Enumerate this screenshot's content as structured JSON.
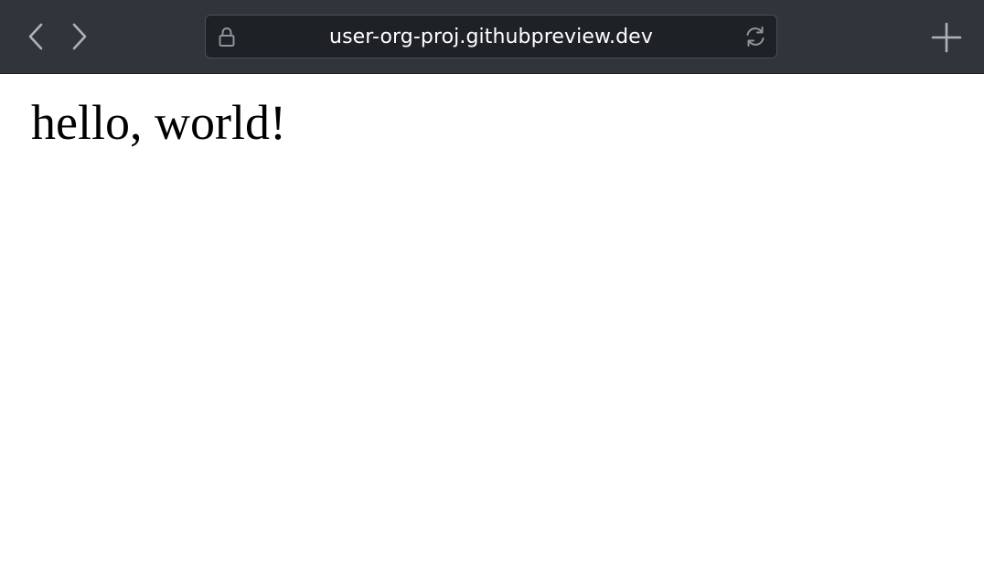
{
  "toolbar": {
    "back_icon": "chevron-left-icon",
    "forward_icon": "chevron-right-icon",
    "address_bar": {
      "lock_icon": "lock-icon",
      "url": "user-org-proj.githubpreview.dev",
      "reload_icon": "reload-icon"
    },
    "new_tab_icon": "plus-icon",
    "colors": {
      "background": "#30353c",
      "address_bar_background": "#1e2125",
      "icon": "#aeb3b9"
    }
  },
  "page": {
    "heading": "hello, world!"
  }
}
